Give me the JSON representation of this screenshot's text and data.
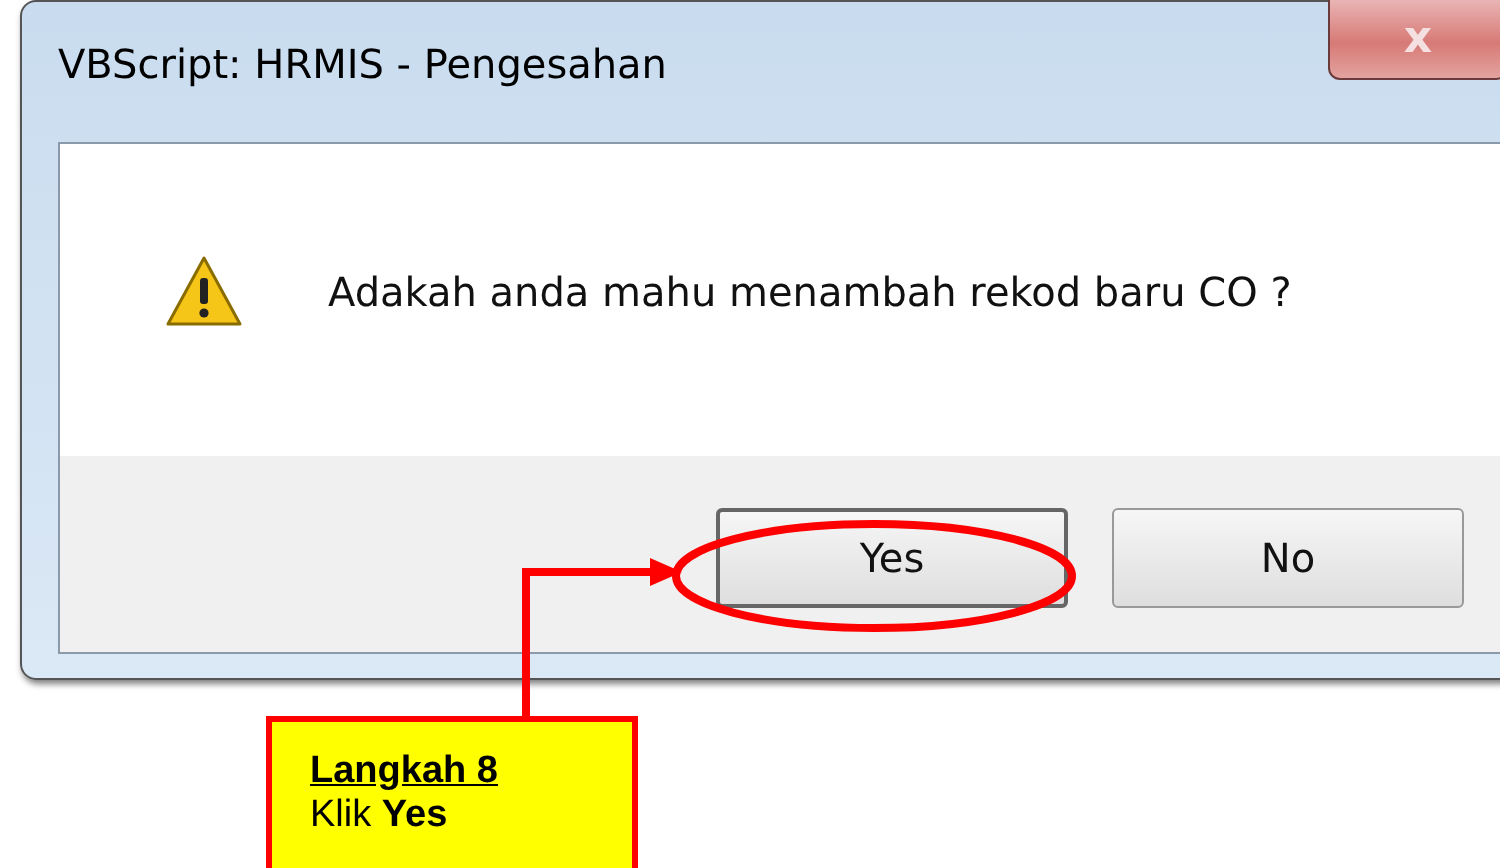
{
  "window": {
    "title": "VBScript: HRMIS - Pengesahan",
    "close_glyph": "x"
  },
  "message": "Adakah anda mahu menambah rekod baru CO ?",
  "buttons": [
    {
      "label": "Yes",
      "highlighted": true
    },
    {
      "label": "No",
      "highlighted": false
    }
  ],
  "callout": {
    "heading": "Langkah 8",
    "text": "Klik **Yes**"
  }
}
